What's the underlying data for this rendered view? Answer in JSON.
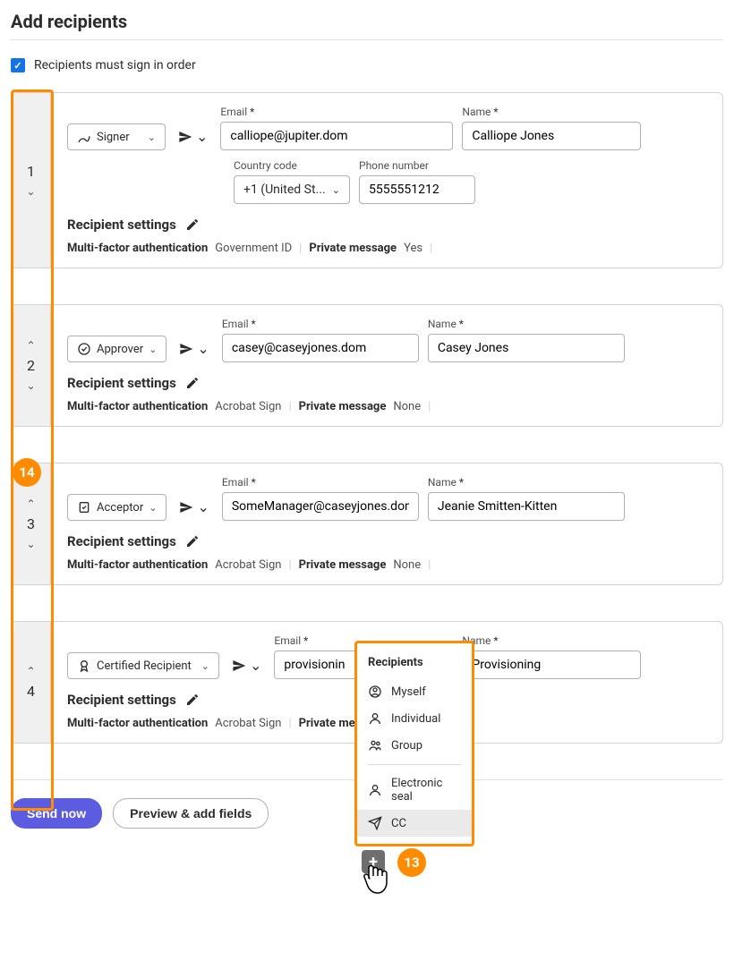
{
  "title": "Add recipients",
  "checkbox": {
    "label": "Recipients must sign in order",
    "checked": true
  },
  "fields": {
    "email": "Email",
    "name": "Name",
    "country": "Country code",
    "phone": "Phone number",
    "required": "*"
  },
  "settings": {
    "title": "Recipient settings",
    "mfa": "Multi-factor authentication",
    "pm": "Private message"
  },
  "recipients": [
    {
      "order": "1",
      "role": "Signer",
      "email": "calliope@jupiter.dom",
      "name": "Calliope Jones",
      "country": "+1 (United St...",
      "phone": "5555551212",
      "mfa": "Government ID",
      "pm": "Yes",
      "showUp": false,
      "showDown": true,
      "showPhone": true
    },
    {
      "order": "2",
      "role": "Approver",
      "email": "casey@caseyjones.dom",
      "name": "Casey Jones",
      "mfa": "Acrobat Sign",
      "pm": "None",
      "showUp": true,
      "showDown": true,
      "showPhone": false
    },
    {
      "order": "3",
      "role": "Acceptor",
      "email": "SomeManager@caseyjones.dom",
      "name": "Jeanie Smitten-Kitten",
      "mfa": "Acrobat Sign",
      "pm": "None",
      "showUp": true,
      "showDown": true,
      "showPhone": false
    },
    {
      "order": "4",
      "role": "Certified Recipient",
      "email": "provisionin",
      "name": "Provisioning",
      "mfa": "Acrobat Sign",
      "pm_truncated": "Private mess",
      "showUp": true,
      "showDown": false,
      "showPhone": false,
      "wide": true,
      "overlapped": true
    }
  ],
  "popup": {
    "title": "Recipients",
    "items": [
      "Myself",
      "Individual",
      "Group"
    ],
    "items2": [
      "Electronic seal",
      "CC"
    ]
  },
  "badges": {
    "left": "14",
    "add": "13"
  },
  "buttons": {
    "send": "Send now",
    "preview": "Preview & add fields"
  }
}
